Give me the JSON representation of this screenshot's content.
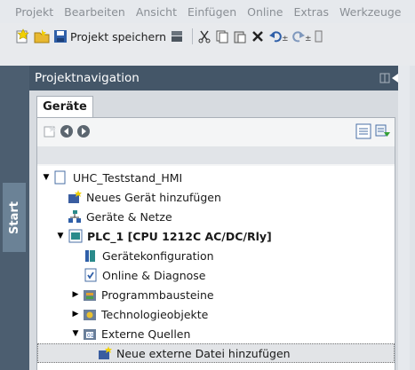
{
  "menu": [
    "Projekt",
    "Bearbeiten",
    "Ansicht",
    "Einfügen",
    "Online",
    "Extras",
    "Werkzeuge"
  ],
  "toolbar": {
    "save_label": "Projekt speichern"
  },
  "sidebar": {
    "start_label": "Start"
  },
  "panel": {
    "title": "Projektnavigation"
  },
  "tabs": {
    "devices": "Geräte"
  },
  "tree": {
    "root": "UHC_Teststand_HMI",
    "add_device": "Neues Gerät hinzufügen",
    "devices_networks": "Geräte & Netze",
    "plc": "PLC_1 [CPU 1212C AC/DC/Rly]",
    "device_config": "Gerätekonfiguration",
    "online_diag": "Online & Diagnose",
    "program_blocks": "Programmbausteine",
    "tech_objects": "Technologieobjekte",
    "external_sources": "Externe Quellen",
    "add_external_file": "Neue externe Datei hinzufügen"
  },
  "colors": {
    "panel_header": "#445668",
    "sidebar": "#4c5e70",
    "tree_bg": "#ffffff"
  }
}
